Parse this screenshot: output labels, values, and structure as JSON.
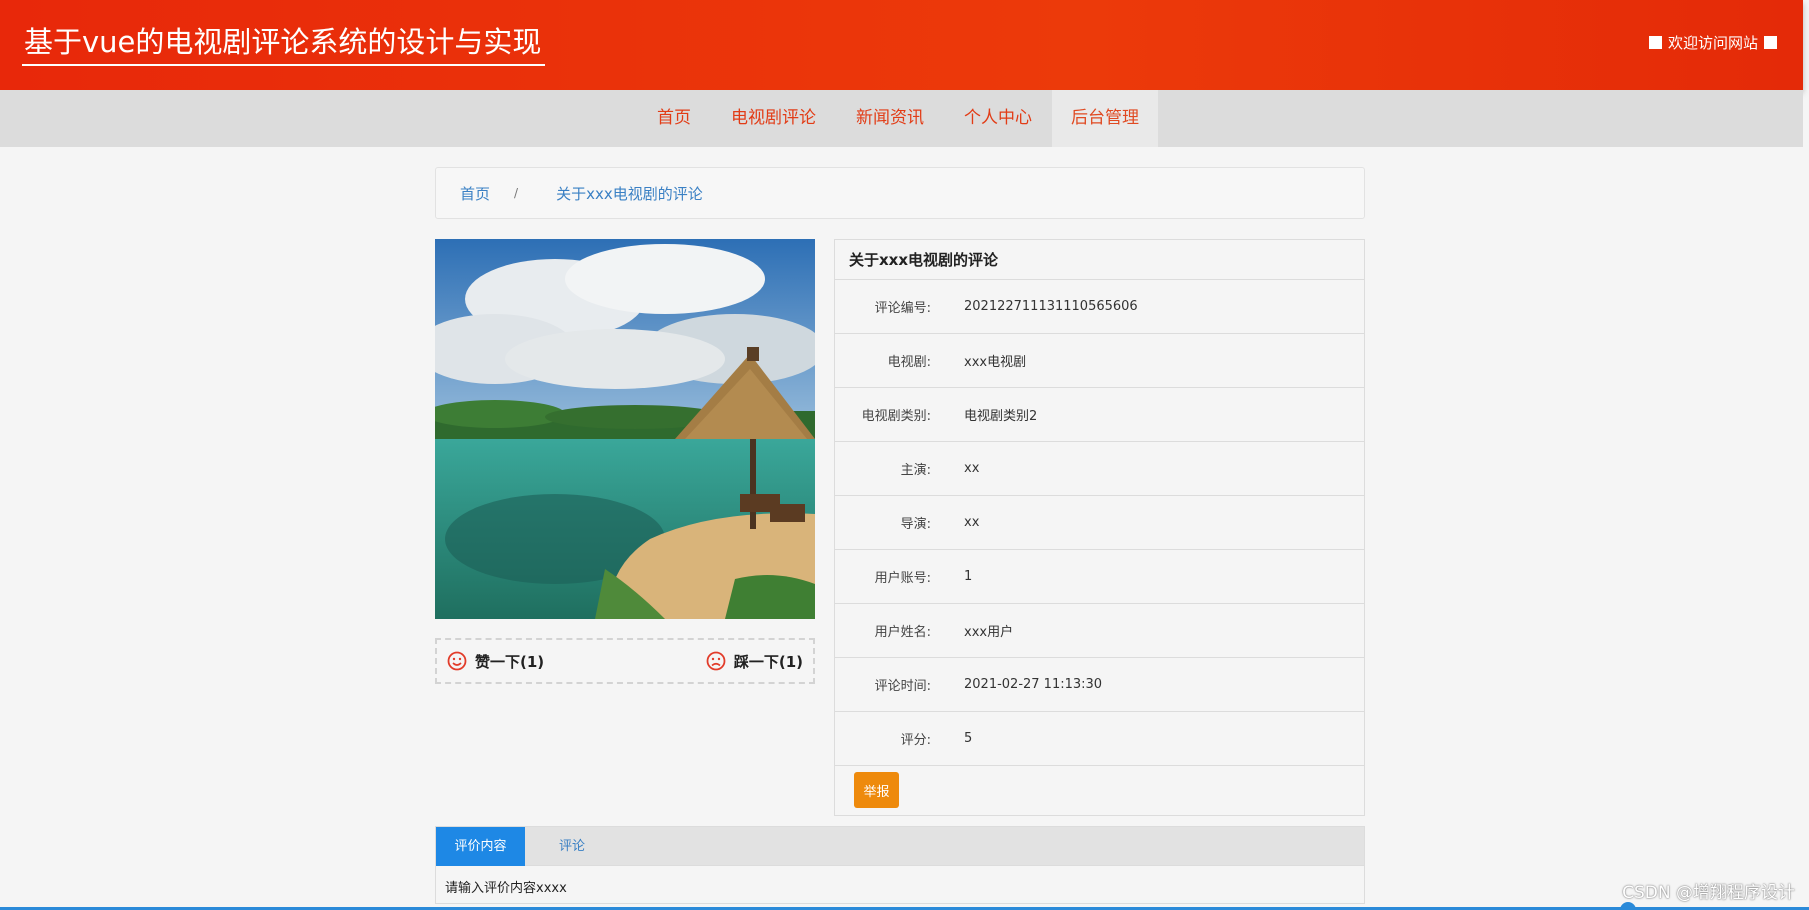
{
  "header": {
    "title": "基于vue的电视剧评论系统的设计与实现",
    "welcome": "欢迎访问网站"
  },
  "nav": {
    "items": [
      {
        "label": "首页"
      },
      {
        "label": "电视剧评论"
      },
      {
        "label": "新闻资讯"
      },
      {
        "label": "个人中心"
      },
      {
        "label": "后台管理"
      }
    ]
  },
  "breadcrumb": {
    "home": "首页",
    "separator": "/",
    "current": "关于xxx电视剧的评论"
  },
  "vote": {
    "like_label": "赞一下(1)",
    "dislike_label": "踩一下(1)"
  },
  "detail": {
    "title": "关于xxx电视剧的评论",
    "rows": [
      {
        "label": "评论编号:",
        "value": "20212271113111056560​6"
      },
      {
        "label": "电视剧:",
        "value": "xxx电视剧"
      },
      {
        "label": "电视剧类别:",
        "value": "电视剧类别2"
      },
      {
        "label": "主演:",
        "value": "xx"
      },
      {
        "label": "导演:",
        "value": "xx"
      },
      {
        "label": "用户账号:",
        "value": "1"
      },
      {
        "label": "用户姓名:",
        "value": "xxx用户"
      },
      {
        "label": "评论时间:",
        "value": "2021-02-27 11:13:30"
      },
      {
        "label": "评分:",
        "value": "5"
      }
    ],
    "report_label": "举报"
  },
  "tabs": {
    "items": [
      {
        "label": "评价内容"
      },
      {
        "label": "评论"
      }
    ],
    "content": "请输入评价内容xxxx"
  },
  "watermark": "CSDN @增翔程序设计",
  "colors": {
    "header": "#e8280a",
    "nav_text": "#e23c16",
    "link": "#3a80c4",
    "report": "#ee8a0c",
    "tab_active": "#1e88e5"
  }
}
